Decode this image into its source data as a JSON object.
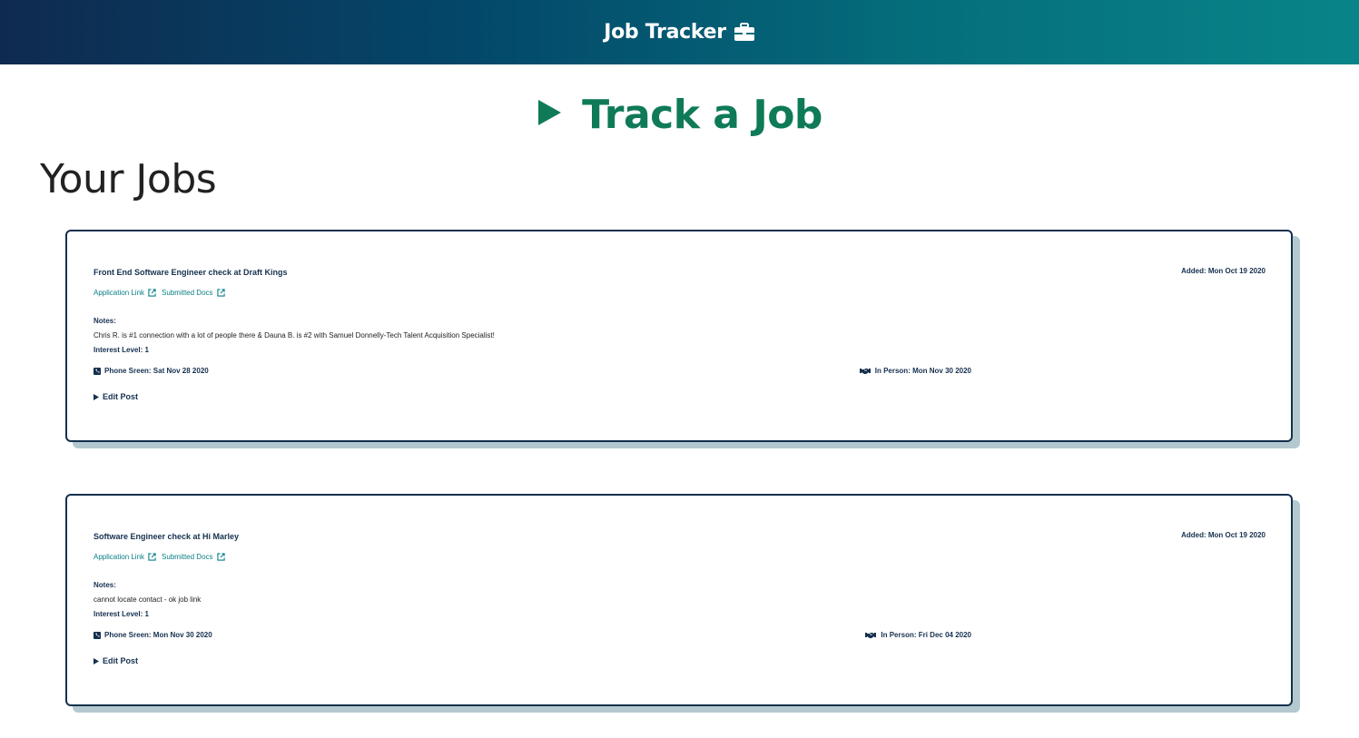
{
  "header": {
    "brand": "Job Tracker",
    "brand_icon": "briefcase-icon"
  },
  "track": {
    "label": "Track a Job",
    "icon": "triangle-right-icon"
  },
  "section_title": "Your Jobs",
  "jobs": [
    {
      "title": "Front End Software Engineer check at Draft Kings",
      "added": "Added: Mon Oct 19 2020",
      "application_link": "Application Link",
      "submitted_docs": "Submitted Docs",
      "notes_label": "Notes:",
      "notes": "Chris R. is #1 connection with a lot of people there & Dauna B. is #2 with Samuel Donnelly-Tech Talent Acquisition Specialist!",
      "interest": "Interest Level: 1",
      "phone_screen": "Phone Sreen: Sat Nov 28 2020",
      "in_person": "In Person: Mon Nov 30 2020",
      "edit": "Edit Post"
    },
    {
      "title": "Software Engineer check at Hi Marley",
      "added": "Added: Mon Oct 19 2020",
      "application_link": "Application Link",
      "submitted_docs": "Submitted Docs",
      "notes_label": "Notes:",
      "notes": "cannot locate contact - ok job link",
      "interest": "Interest Level: 1",
      "phone_screen": "Phone Sreen: Mon Nov 30 2020",
      "in_person": "In Person: Fri Dec 04 2020",
      "edit": "Edit Post"
    }
  ],
  "colors": {
    "accent_green": "#0f7a58",
    "link_teal": "#0a7f86",
    "navy": "#15304f"
  }
}
